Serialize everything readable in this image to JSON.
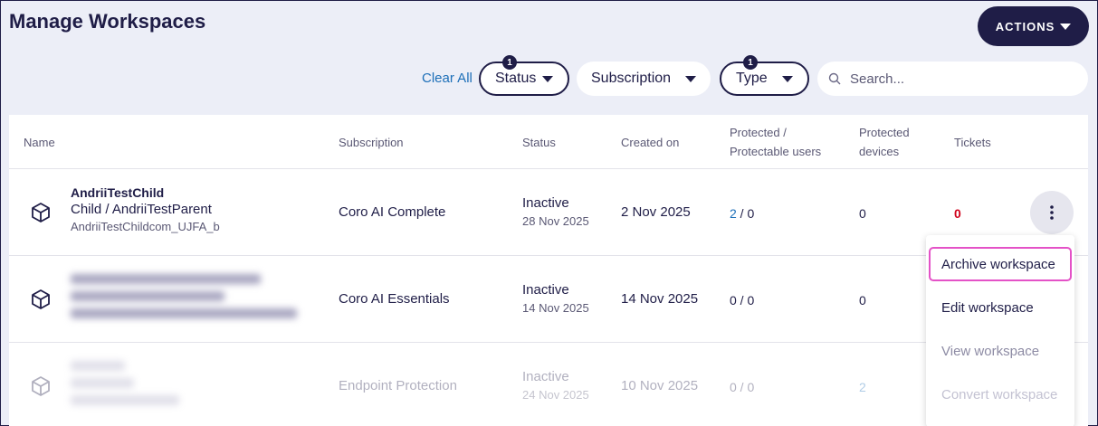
{
  "header": {
    "title": "Manage Workspaces",
    "actions_label": "ACTIONS"
  },
  "filters": {
    "clear_all": "Clear All",
    "status": {
      "label": "Status",
      "badge": "1"
    },
    "subscription": {
      "label": "Subscription"
    },
    "type": {
      "label": "Type",
      "badge": "1"
    },
    "search_placeholder": "Search..."
  },
  "table": {
    "columns": {
      "name": "Name",
      "subscription": "Subscription",
      "status": "Status",
      "created_on": "Created on",
      "protected_users_1": "Protected /",
      "protected_users_2": "Protectable users",
      "protected_devices_1": "Protected",
      "protected_devices_2": "devices",
      "tickets": "Tickets"
    },
    "rows": [
      {
        "name": "AndriiTestChild",
        "hierarchy": "Child / AndriiTestParent",
        "id": "AndriiTestChildcom_UJFA_b",
        "subscription": "Coro AI Complete",
        "status": "Inactive",
        "status_date": "28 Nov 2025",
        "created_on": "2 Nov 2025",
        "protected_users": "2",
        "protectable_users": " / 0",
        "devices": "0",
        "tickets": "0"
      },
      {
        "subscription": "Coro AI Essentials",
        "status": "Inactive",
        "status_date": "14 Nov 2025",
        "created_on": "14 Nov 2025",
        "users": "0 / 0",
        "devices": "0"
      },
      {
        "subscription": "Endpoint Protection",
        "status": "Inactive",
        "status_date": "24 Nov 2025",
        "created_on": "10 Nov 2025",
        "users": "0 / 0",
        "devices": "2"
      }
    ]
  },
  "context_menu": {
    "items": [
      "Archive workspace",
      "Edit workspace",
      "View workspace",
      "Convert workspace"
    ]
  },
  "colors": {
    "primary": "#1f1d47",
    "link": "#1d6fb8",
    "danger": "#d0021b",
    "highlight": "#e452c7"
  }
}
